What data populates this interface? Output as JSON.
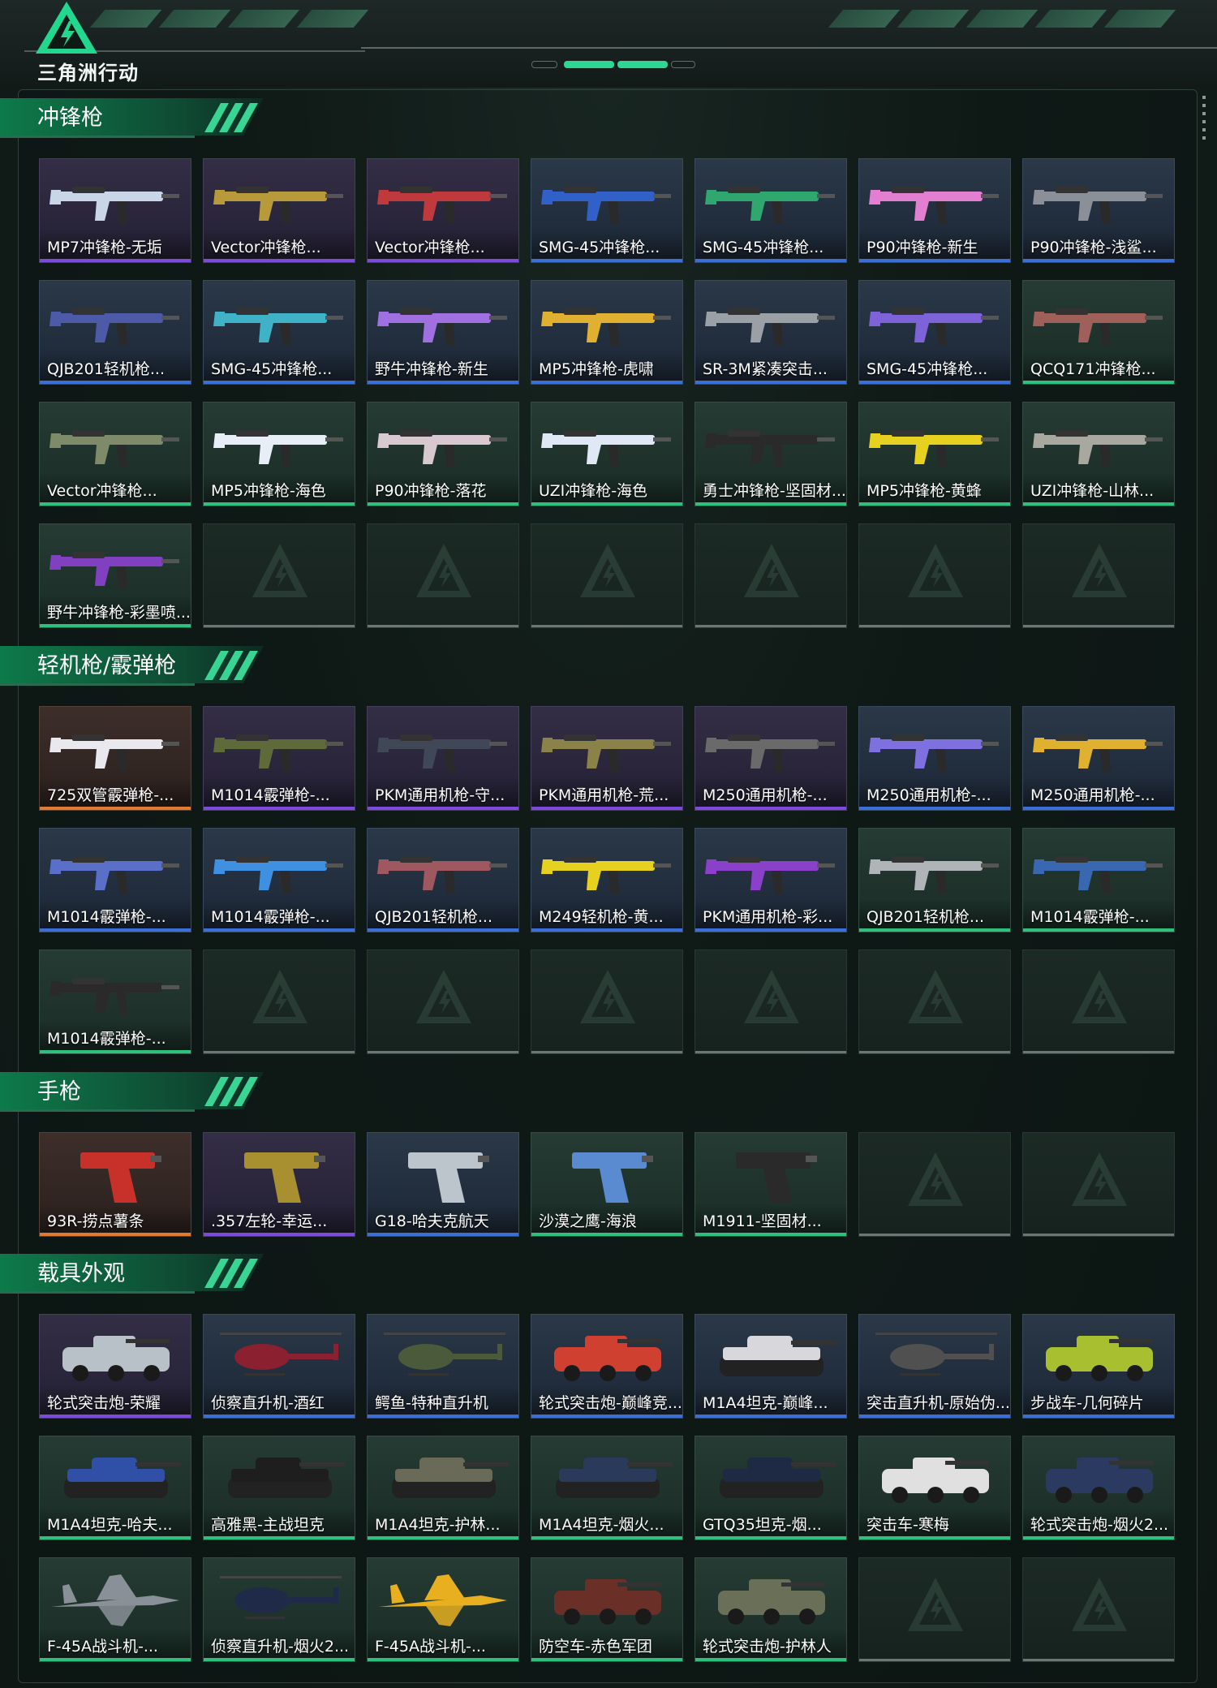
{
  "app": {
    "logo_text": "三角洲行动",
    "accent_color": "#2dd692"
  },
  "rarity_colors": {
    "purple": "#7c4bdc",
    "blue": "#3a6fd8",
    "green": "#2fc07e",
    "orange": "#e07a30",
    "empty": "#6b7773"
  },
  "sections": [
    {
      "title": "冲锋枪",
      "items": [
        {
          "name": "MP7冲锋枪-无垢",
          "rarity": "purple",
          "kind": "gun",
          "color": "#c8d6e8"
        },
        {
          "name": "Vector冲锋枪...",
          "rarity": "purple",
          "kind": "gun",
          "color": "#b89a3a"
        },
        {
          "name": "Vector冲锋枪...",
          "rarity": "purple",
          "kind": "gun",
          "color": "#c0393d"
        },
        {
          "name": "SMG-45冲锋枪...",
          "rarity": "blue",
          "kind": "gun",
          "color": "#3060c8"
        },
        {
          "name": "SMG-45冲锋枪...",
          "rarity": "blue",
          "kind": "gun",
          "color": "#2fa76f"
        },
        {
          "name": "P90冲锋枪-新生",
          "rarity": "blue",
          "kind": "gun",
          "color": "#e27fd0"
        },
        {
          "name": "P90冲锋枪-浅鲨...",
          "rarity": "blue",
          "kind": "gun",
          "color": "#8a8f98"
        },
        {
          "name": "QJB201轻机枪...",
          "rarity": "blue",
          "kind": "gun",
          "color": "#4d5aa8"
        },
        {
          "name": "SMG-45冲锋枪...",
          "rarity": "blue",
          "kind": "gun",
          "color": "#3fb2c8"
        },
        {
          "name": "野牛冲锋枪-新生",
          "rarity": "blue",
          "kind": "gun",
          "color": "#a070e0"
        },
        {
          "name": "MP5冲锋枪-虎啸",
          "rarity": "blue",
          "kind": "gun",
          "color": "#e0b030"
        },
        {
          "name": "SR-3M紧凑突击...",
          "rarity": "blue",
          "kind": "gun",
          "color": "#9aa0a6"
        },
        {
          "name": "SMG-45冲锋枪...",
          "rarity": "blue",
          "kind": "gun",
          "color": "#7d62d8"
        },
        {
          "name": "QCQ171冲锋枪...",
          "rarity": "green",
          "kind": "gun",
          "color": "#a0605a"
        },
        {
          "name": "Vector冲锋枪...",
          "rarity": "green",
          "kind": "gun",
          "color": "#7f8a6a"
        },
        {
          "name": "MP5冲锋枪-海色",
          "rarity": "green",
          "kind": "gun",
          "color": "#e8eef8"
        },
        {
          "name": "P90冲锋枪-落花",
          "rarity": "green",
          "kind": "gun",
          "color": "#d8c8d0"
        },
        {
          "name": "UZI冲锋枪-海色",
          "rarity": "green",
          "kind": "gun",
          "color": "#dfe8f4"
        },
        {
          "name": "勇士冲锋枪-坚固材...",
          "rarity": "green",
          "kind": "gun",
          "color": "#2a2a2a"
        },
        {
          "name": "MP5冲锋枪-黄蜂",
          "rarity": "green",
          "kind": "gun",
          "color": "#e6d020"
        },
        {
          "name": "UZI冲锋枪-山林...",
          "rarity": "green",
          "kind": "gun",
          "color": "#a8a8a0"
        },
        {
          "name": "野牛冲锋枪-彩墨喷...",
          "rarity": "green",
          "kind": "gun",
          "color": "#8040c0"
        },
        {
          "name": "",
          "rarity": "empty"
        },
        {
          "name": "",
          "rarity": "empty"
        },
        {
          "name": "",
          "rarity": "empty"
        },
        {
          "name": "",
          "rarity": "empty"
        },
        {
          "name": "",
          "rarity": "empty"
        },
        {
          "name": "",
          "rarity": "empty"
        }
      ]
    },
    {
      "title": "轻机枪/霰弹枪",
      "items": [
        {
          "name": "725双管霰弹枪-...",
          "rarity": "orange",
          "kind": "gun",
          "color": "#e8e8ee"
        },
        {
          "name": "M1014霰弹枪-...",
          "rarity": "purple",
          "kind": "gun",
          "color": "#5e6a3a"
        },
        {
          "name": "PKM通用机枪-守...",
          "rarity": "purple",
          "kind": "gun",
          "color": "#404858"
        },
        {
          "name": "PKM通用机枪-荒...",
          "rarity": "purple",
          "kind": "gun",
          "color": "#8a8248"
        },
        {
          "name": "M250通用机枪-...",
          "rarity": "purple",
          "kind": "gun",
          "color": "#6a6a6a"
        },
        {
          "name": "M250通用机枪-...",
          "rarity": "blue",
          "kind": "gun",
          "color": "#7f70e0"
        },
        {
          "name": "M250通用机枪-...",
          "rarity": "blue",
          "kind": "gun",
          "color": "#e0b030"
        },
        {
          "name": "M1014霰弹枪-...",
          "rarity": "blue",
          "kind": "gun",
          "color": "#5a70c8"
        },
        {
          "name": "M1014霰弹枪-...",
          "rarity": "blue",
          "kind": "gun",
          "color": "#3f90e0"
        },
        {
          "name": "QJB201轻机枪...",
          "rarity": "blue",
          "kind": "gun",
          "color": "#a05860"
        },
        {
          "name": "M249轻机枪-黄...",
          "rarity": "blue",
          "kind": "gun",
          "color": "#e6d020"
        },
        {
          "name": "PKM通用机枪-彩...",
          "rarity": "blue",
          "kind": "gun",
          "color": "#8a40c8"
        },
        {
          "name": "QJB201轻机枪...",
          "rarity": "green",
          "kind": "gun",
          "color": "#b0b4b8"
        },
        {
          "name": "M1014霰弹枪-...",
          "rarity": "green",
          "kind": "gun",
          "color": "#3a68b0"
        },
        {
          "name": "M1014霰弹枪-...",
          "rarity": "green",
          "kind": "gun",
          "color": "#2a2a2a"
        },
        {
          "name": "",
          "rarity": "empty"
        },
        {
          "name": "",
          "rarity": "empty"
        },
        {
          "name": "",
          "rarity": "empty"
        },
        {
          "name": "",
          "rarity": "empty"
        },
        {
          "name": "",
          "rarity": "empty"
        },
        {
          "name": "",
          "rarity": "empty"
        }
      ]
    },
    {
      "title": "手枪",
      "items": [
        {
          "name": "93R-捞点薯条",
          "rarity": "orange",
          "kind": "pistol",
          "color": "#c8302a"
        },
        {
          "name": ".357左轮-幸运...",
          "rarity": "purple",
          "kind": "pistol",
          "color": "#a89030"
        },
        {
          "name": "G18-哈夫克航天",
          "rarity": "blue",
          "kind": "pistol",
          "color": "#bcc4cc"
        },
        {
          "name": "沙漠之鹰-海浪",
          "rarity": "green",
          "kind": "pistol",
          "color": "#5a8ad0"
        },
        {
          "name": "M1911-坚固材...",
          "rarity": "green",
          "kind": "pistol",
          "color": "#2a2a2a"
        },
        {
          "name": "",
          "rarity": "empty"
        },
        {
          "name": "",
          "rarity": "empty"
        }
      ]
    },
    {
      "title": "载具外观",
      "items": [
        {
          "name": "轮式突击炮-荣耀",
          "rarity": "purple",
          "kind": "car",
          "color": "#b8c0c8"
        },
        {
          "name": "侦察直升机-酒红",
          "rarity": "blue",
          "kind": "heli",
          "color": "#8a2030"
        },
        {
          "name": "鳄鱼-特种直升机",
          "rarity": "blue",
          "kind": "heli",
          "color": "#4a5a3a"
        },
        {
          "name": "轮式突击炮-巅峰竞...",
          "rarity": "blue",
          "kind": "car",
          "color": "#d04030"
        },
        {
          "name": "M1A4坦克-巅峰...",
          "rarity": "blue",
          "kind": "tank",
          "color": "#d8d8dc"
        },
        {
          "name": "突击直升机-原始伪...",
          "rarity": "blue",
          "kind": "heli",
          "color": "#505050"
        },
        {
          "name": "步战车-几何碎片",
          "rarity": "blue",
          "kind": "car",
          "color": "#a8c030"
        },
        {
          "name": "M1A4坦克-哈夫...",
          "rarity": "green",
          "kind": "tank",
          "color": "#3050a8"
        },
        {
          "name": "高雅黑-主战坦克",
          "rarity": "green",
          "kind": "tank",
          "color": "#1e1e1e"
        },
        {
          "name": "M1A4坦克-护林...",
          "rarity": "green",
          "kind": "tank",
          "color": "#6a6a58"
        },
        {
          "name": "M1A4坦克-烟火...",
          "rarity": "green",
          "kind": "tank",
          "color": "#2a3a5a"
        },
        {
          "name": "GTQ35坦克-烟...",
          "rarity": "green",
          "kind": "tank",
          "color": "#1e2a44"
        },
        {
          "name": "突击车-寒梅",
          "rarity": "green",
          "kind": "car",
          "color": "#e0e0e0"
        },
        {
          "name": "轮式突击炮-烟火2...",
          "rarity": "green",
          "kind": "car",
          "color": "#2a3a60"
        },
        {
          "name": "F-45A战斗机-...",
          "rarity": "green",
          "kind": "jet",
          "color": "#8a9098"
        },
        {
          "name": "侦察直升机-烟火2...",
          "rarity": "green",
          "kind": "heli",
          "color": "#1e2a48"
        },
        {
          "name": "F-45A战斗机-...",
          "rarity": "green",
          "kind": "jet",
          "color": "#e8b020"
        },
        {
          "name": "防空车-赤色军团",
          "rarity": "green",
          "kind": "car",
          "color": "#6a3028"
        },
        {
          "name": "轮式突击炮-护林人",
          "rarity": "green",
          "kind": "car",
          "color": "#6a7058"
        },
        {
          "name": "",
          "rarity": "empty"
        },
        {
          "name": "",
          "rarity": "empty"
        }
      ]
    }
  ]
}
